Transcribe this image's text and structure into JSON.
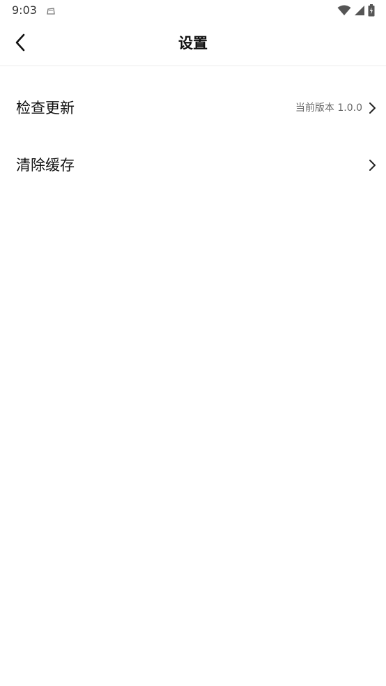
{
  "status_bar": {
    "time": "9:03",
    "icons": [
      "notification-icon",
      "wifi-icon",
      "signal-icon",
      "battery-icon"
    ]
  },
  "header": {
    "title": "设置",
    "back_icon": "chevron-left-icon"
  },
  "settings": {
    "items": [
      {
        "label": "检查更新",
        "value": "当前版本 1.0.0",
        "icon": "chevron-right-icon"
      },
      {
        "label": "清除缓存",
        "value": "",
        "icon": "chevron-right-icon"
      }
    ]
  },
  "colors": {
    "background": "#ffffff",
    "text_primary": "#111111",
    "text_secondary": "#666666",
    "divider": "#ececec"
  }
}
